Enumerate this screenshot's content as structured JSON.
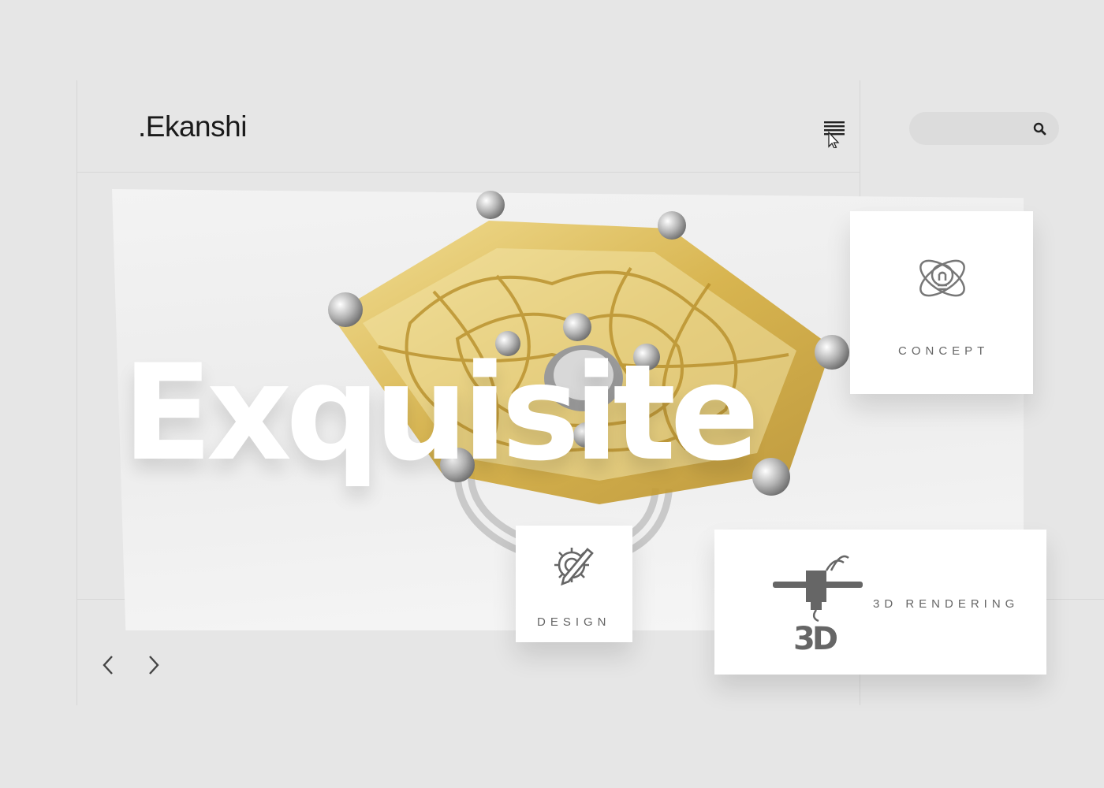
{
  "brand": {
    "logo_text": ".Ekanshi"
  },
  "header": {
    "menu_icon": "menu-lines-icon",
    "search": {
      "placeholder": "",
      "value": "",
      "icon": "search-icon"
    }
  },
  "hero": {
    "headline": "Exquisite",
    "image": "gold-filigree-ring"
  },
  "cards": {
    "concept": {
      "label": "CONCEPT",
      "icon": "lightbulb-atom-icon"
    },
    "design": {
      "label": "DESIGN",
      "icon": "gear-pencil-icon"
    },
    "rendering": {
      "label": "3D RENDERING",
      "icon": "3d-printer-icon"
    }
  },
  "carousel": {
    "prev_icon": "chevron-left-icon",
    "next_icon": "chevron-right-icon"
  },
  "colors": {
    "background": "#e6e6e6",
    "gold": "#d9b64a",
    "silver": "#a9a9a9",
    "text": "#1a1a1a"
  }
}
